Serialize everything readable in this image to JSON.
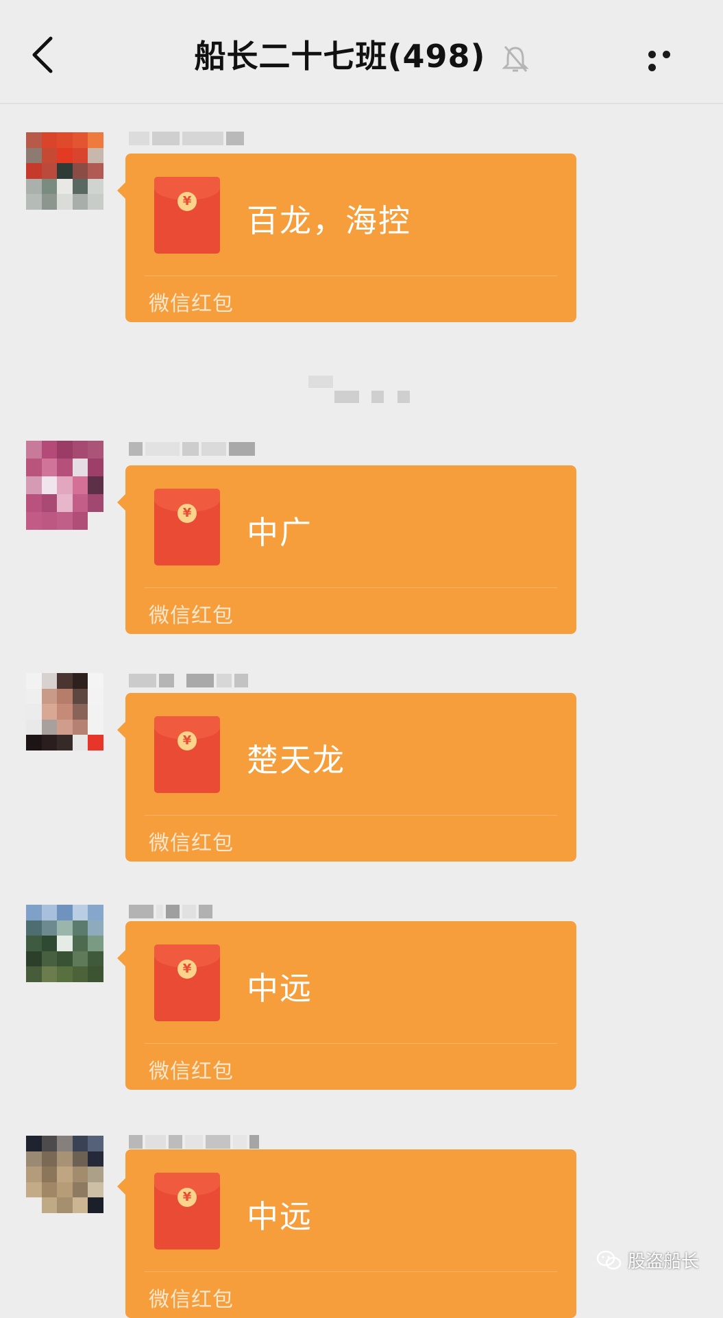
{
  "header": {
    "title": "船长二十七班(498)"
  },
  "messages": [
    {
      "text": "百龙，海控",
      "footer": "微信红包"
    },
    {
      "text": "中广",
      "footer": "微信红包"
    },
    {
      "text": "楚天龙",
      "footer": "微信红包"
    },
    {
      "text": "中远",
      "footer": "微信红包"
    },
    {
      "text": "中远",
      "footer": "微信红包"
    }
  ],
  "watermark": {
    "text": "股盗船长"
  },
  "colors": {
    "bubble": "#f69e3b",
    "envelope": "#e94b35",
    "background": "#ededed"
  },
  "icons": [
    "back-icon",
    "mute-bell-icon",
    "more-icon",
    "red-envelope-icon",
    "wechat-icon"
  ]
}
